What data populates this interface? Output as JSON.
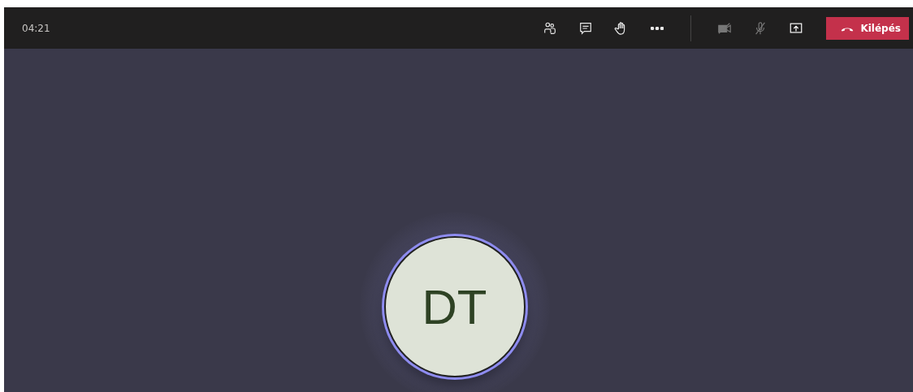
{
  "toolbar": {
    "timer": "04:21",
    "controls": [
      {
        "kind": "people",
        "disabled": false
      },
      {
        "kind": "chat",
        "disabled": false
      },
      {
        "kind": "hand",
        "disabled": false
      },
      {
        "kind": "more",
        "disabled": false
      },
      {
        "kind": "divider"
      },
      {
        "kind": "camera",
        "disabled": true
      },
      {
        "kind": "mic",
        "disabled": true
      },
      {
        "kind": "share",
        "disabled": false
      }
    ],
    "leave_button": {
      "label": "Kilépés"
    }
  },
  "participant": {
    "initials": "DT",
    "speaking": true
  }
}
